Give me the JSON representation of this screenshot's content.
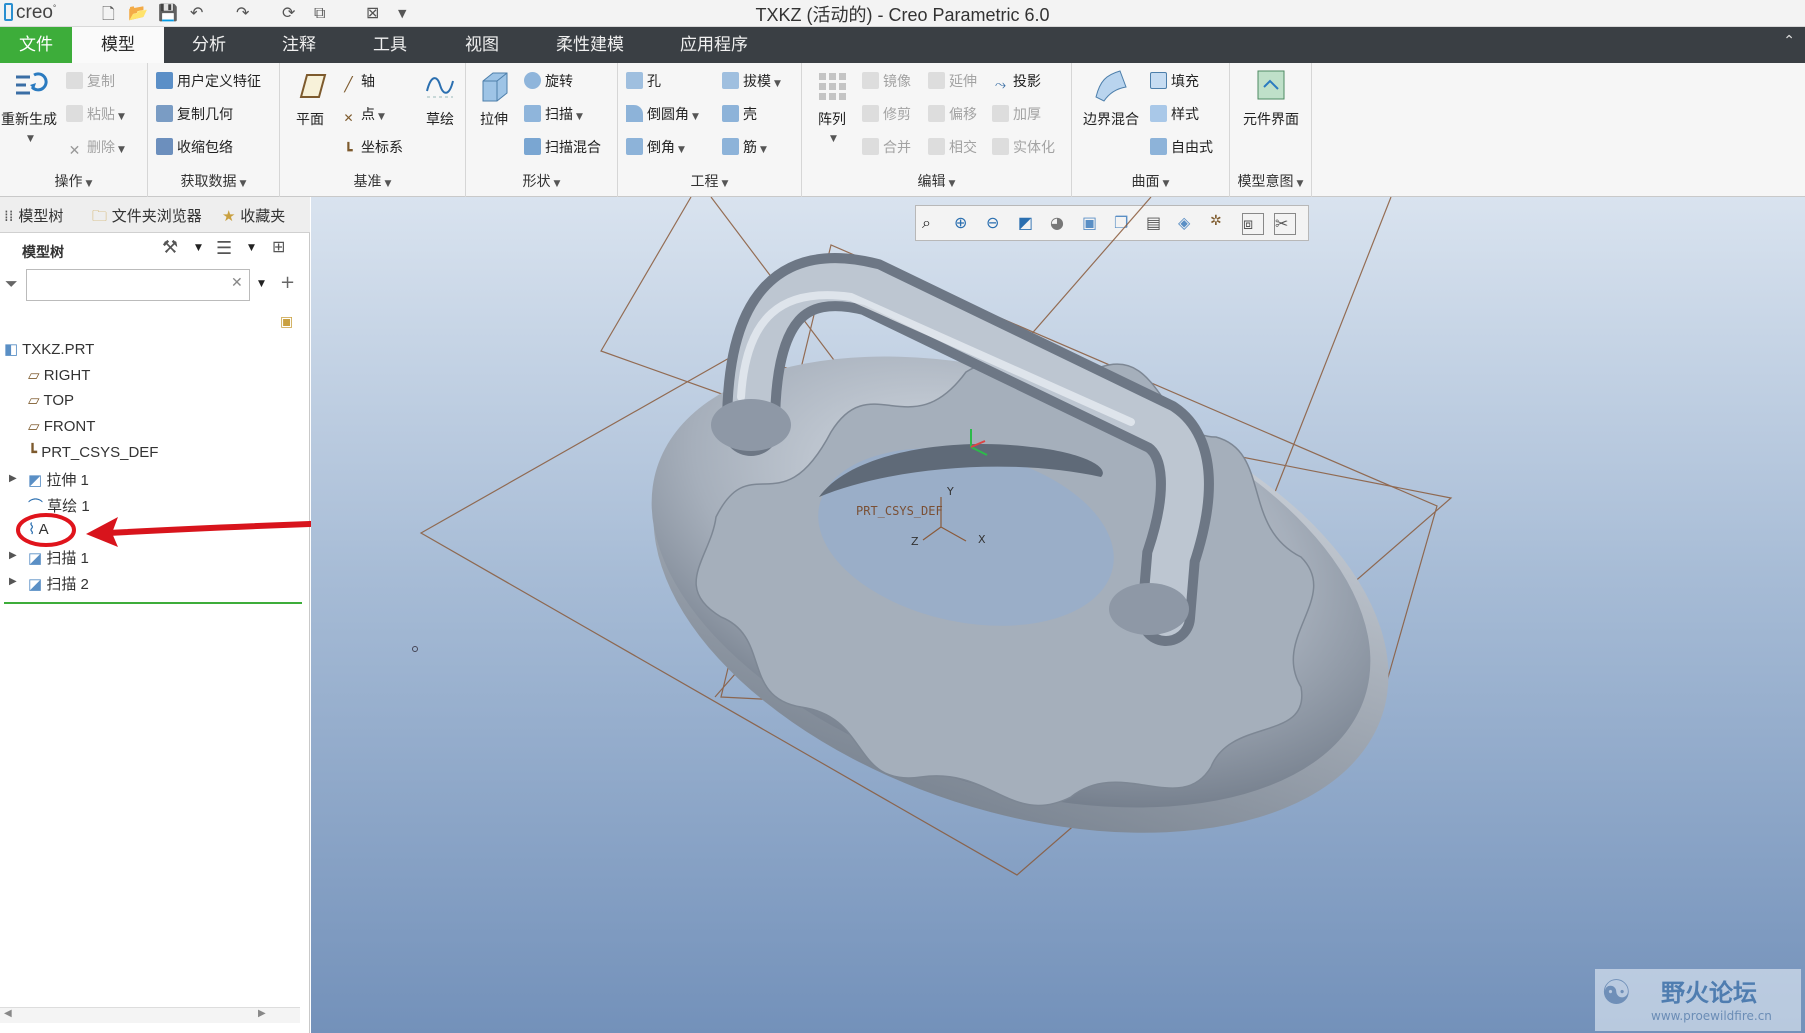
{
  "app": {
    "logo": "creo",
    "window_title": "TXKZ (活动的) - Creo Parametric 6.0"
  },
  "tabs": [
    {
      "label": "文件"
    },
    {
      "label": "模型"
    },
    {
      "label": "分析"
    },
    {
      "label": "注释"
    },
    {
      "label": "工具"
    },
    {
      "label": "视图"
    },
    {
      "label": "柔性建模"
    },
    {
      "label": "应用程序"
    }
  ],
  "ribbon": {
    "groups": {
      "ops": "操作",
      "getdata": "获取数据",
      "datum": "基准",
      "shapes": "形状",
      "engineering": "工程",
      "editing": "编辑",
      "surfaces": "曲面",
      "intent": "模型意图"
    },
    "ops": {
      "regen": "重新生成",
      "copy": "复制",
      "paste": "粘贴",
      "delete": "删除"
    },
    "getdata": {
      "udf": "用户定义特征",
      "copy_geom": "复制几何",
      "shrinkwrap": "收缩包络"
    },
    "datum": {
      "plane": "平面",
      "axis": "轴",
      "point": "点",
      "csys": "坐标系",
      "sketch": "草绘"
    },
    "shapes": {
      "extrude": "拉伸",
      "revolve": "旋转",
      "sweep": "扫描",
      "swept_blend": "扫描混合"
    },
    "engineering": {
      "hole": "孔",
      "draft": "拔模",
      "round": "倒圆角",
      "shell": "壳",
      "chamfer": "倒角",
      "rib": "筋"
    },
    "editing": {
      "pattern": "阵列",
      "mirror": "镜像",
      "extend": "延伸",
      "project": "投影",
      "trim": "修剪",
      "offset": "偏移",
      "thicken": "加厚",
      "merge": "合并",
      "intersect": "相交",
      "solidify": "实体化"
    },
    "surfaces": {
      "boundary_blend": "边界混合",
      "fill": "填充",
      "style": "样式",
      "freestyle": "自由式"
    },
    "intent": {
      "component_interface": "元件界面"
    }
  },
  "panel": {
    "tabs": [
      {
        "label": "模型树"
      },
      {
        "label": "文件夹浏览器"
      },
      {
        "label": "收藏夹"
      }
    ],
    "tree_header": "模型树",
    "search_placeholder": "",
    "tree": [
      {
        "label": "TXKZ.PRT"
      },
      {
        "label": "RIGHT"
      },
      {
        "label": "TOP"
      },
      {
        "label": "FRONT"
      },
      {
        "label": "PRT_CSYS_DEF"
      },
      {
        "label": "拉伸 1"
      },
      {
        "label": "草绘 1"
      },
      {
        "label": "A"
      },
      {
        "label": "扫描 1"
      },
      {
        "label": "扫描 2"
      }
    ]
  },
  "viewport": {
    "csys_label": "PRT_CSYS_DEF",
    "axes": {
      "x": "X",
      "y": "Y",
      "z": "Z"
    }
  },
  "watermark": {
    "title": "野火论坛",
    "url": "www.proewildfire.cn"
  },
  "colors": {
    "accent_green": "#3dad3a",
    "tab_bar": "#3a3f44",
    "annotation_red": "#e0141c",
    "datum_lines": "#8a5a3a"
  }
}
